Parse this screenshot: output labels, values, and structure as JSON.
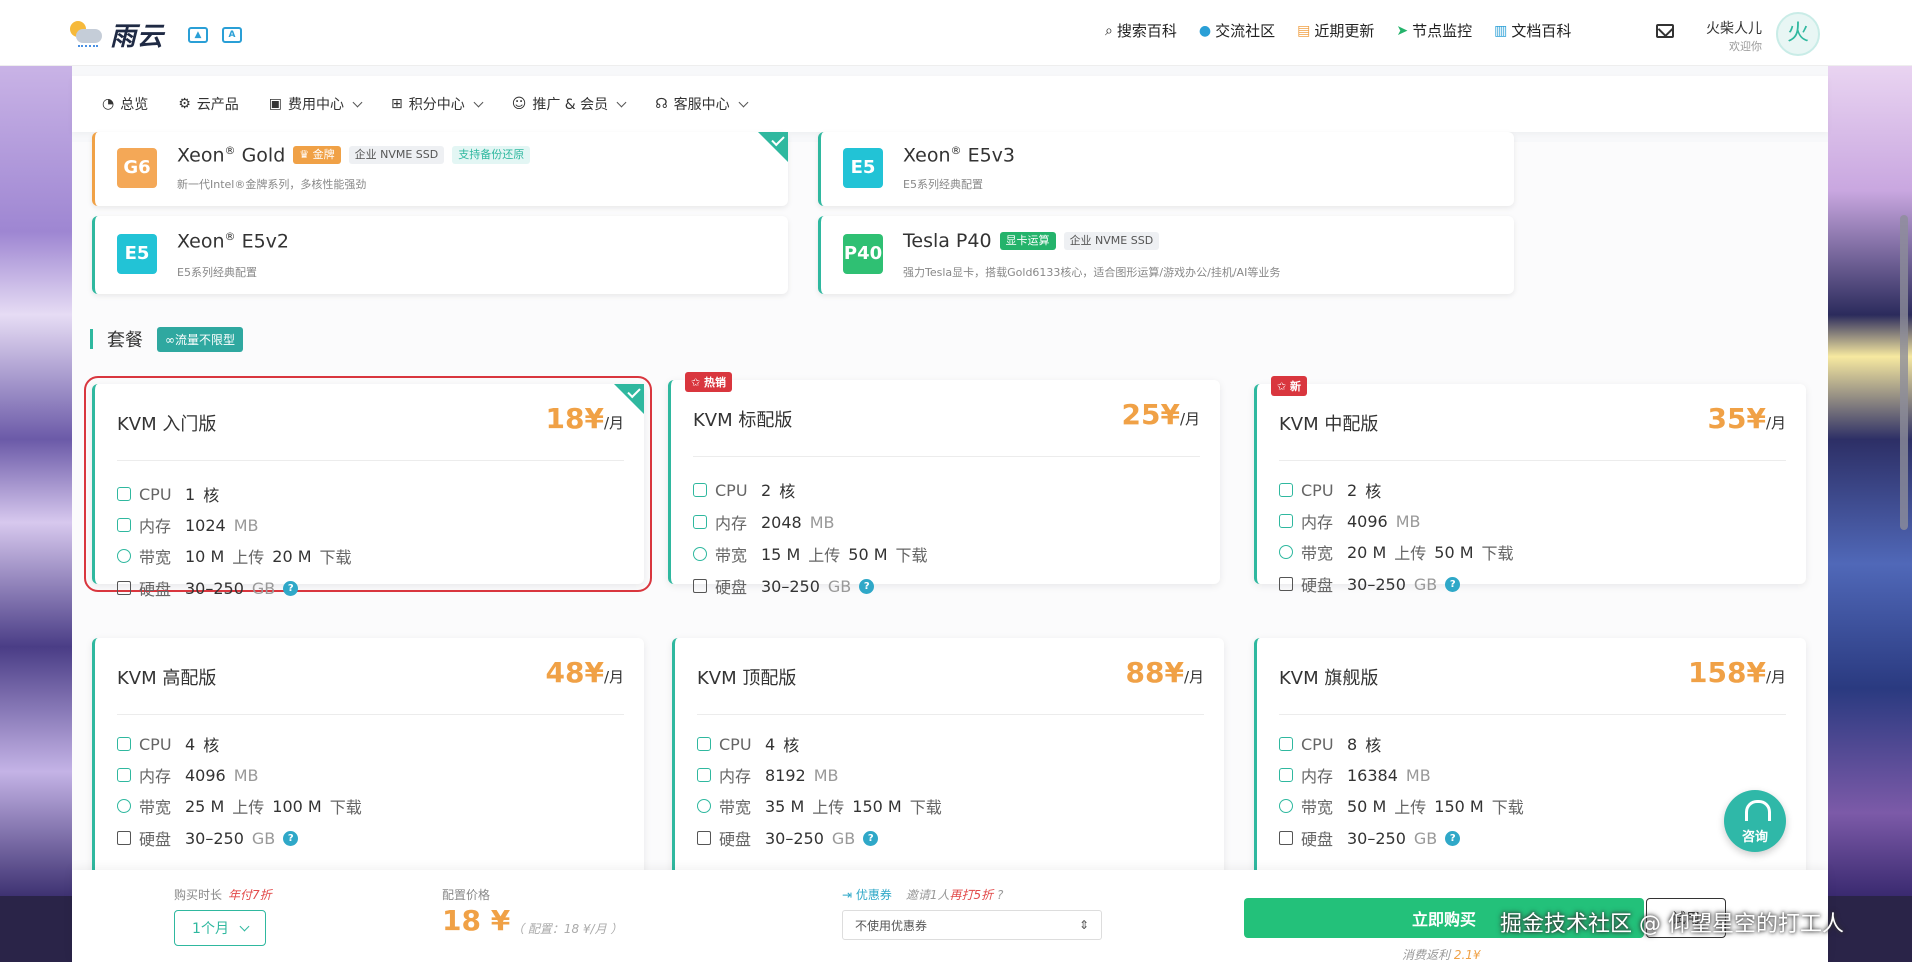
{
  "brand": {
    "name": "雨云"
  },
  "topnav": [
    {
      "icon": "search-icon",
      "glyph": "⌕",
      "label": "搜索百科"
    },
    {
      "icon": "community-icon",
      "glyph": "●",
      "label": "交流社区"
    },
    {
      "icon": "news-icon",
      "glyph": "▤",
      "label": "近期更新"
    },
    {
      "icon": "node-monitor-icon",
      "glyph": "➤",
      "label": "节点监控"
    },
    {
      "icon": "docs-icon",
      "glyph": "▥",
      "label": "文档百科"
    }
  ],
  "user": {
    "name": "火柴人儿",
    "greet": "欢迎你",
    "avatar_char": "火"
  },
  "subnav": [
    {
      "icon": "dashboard-icon",
      "glyph": "◔",
      "label": "总览",
      "dropdown": false
    },
    {
      "icon": "cloud-product-icon",
      "glyph": "⚙",
      "label": "云产品",
      "dropdown": false
    },
    {
      "icon": "billing-icon",
      "glyph": "▣",
      "label": "费用中心",
      "dropdown": true
    },
    {
      "icon": "points-icon",
      "glyph": "⊞",
      "label": "积分中心",
      "dropdown": true
    },
    {
      "icon": "promo-icon",
      "glyph": "☺",
      "label": "推广 & 会员",
      "dropdown": true
    },
    {
      "icon": "support-icon",
      "glyph": "☊",
      "label": "客服中心",
      "dropdown": true
    }
  ],
  "cpus": [
    {
      "badge": "G6",
      "badge_color": "#f4a857",
      "name": "Xeon",
      "reg": "®",
      "model": "Gold",
      "tags": [
        {
          "text": "♛ 金牌",
          "style": "gold"
        },
        {
          "text": "企业 NVME SSD",
          "style": "grey"
        },
        {
          "text": "支持备份还原",
          "style": "teal"
        }
      ],
      "desc": "新一代Intel®金牌系列，多核性能强劲"
    },
    {
      "badge": "E5",
      "badge_color": "#22c3d6",
      "name": "Xeon",
      "reg": "®",
      "model": "E5v3",
      "tags": [],
      "desc": "E5系列经典配置"
    },
    {
      "badge": "E5",
      "badge_color": "#22c3d6",
      "name": "Xeon",
      "reg": "®",
      "model": "E5v2",
      "tags": [],
      "desc": "E5系列经典配置"
    },
    {
      "badge": "P40",
      "badge_color": "#2fc073",
      "name": "Tesla P40",
      "reg": "",
      "model": "",
      "tags": [
        {
          "text": "显卡运算",
          "style": "green"
        },
        {
          "text": "企业 NVME SSD",
          "style": "grey"
        }
      ],
      "desc": "强力Tesla显卡，搭载Gold6133核心，适合图形运算/游戏办公/挂机/AI等业务"
    }
  ],
  "section": {
    "title": "套餐",
    "pill": "∞流量不限型"
  },
  "spec_labels": {
    "cpu": "CPU",
    "mem": "内存",
    "bw": "带宽",
    "disk": "硬盘",
    "core_unit": "核",
    "mem_unit": "MB",
    "up": "上传",
    "down": "下载",
    "disk_unit": "GB",
    "help": "?"
  },
  "packages": [
    {
      "name": "KVM 入门版",
      "price": "18¥",
      "per": "/月",
      "ribbon": "",
      "cpu": "1",
      "mem": "1024",
      "up": "10 M",
      "down": "20 M",
      "disk": "30–250"
    },
    {
      "name": "KVM 标配版",
      "price": "25¥",
      "per": "/月",
      "ribbon": "✩ 热销",
      "cpu": "2",
      "mem": "2048",
      "up": "15 M",
      "down": "50 M",
      "disk": "30–250"
    },
    {
      "name": "KVM 中配版",
      "price": "35¥",
      "per": "/月",
      "ribbon": "✩ 新",
      "cpu": "2",
      "mem": "4096",
      "up": "20 M",
      "down": "50 M",
      "disk": "30–250"
    },
    {
      "name": "KVM 高配版",
      "price": "48¥",
      "per": "/月",
      "ribbon": "",
      "cpu": "4",
      "mem": "4096",
      "up": "25 M",
      "down": "100 M",
      "disk": "30–250"
    },
    {
      "name": "KVM 顶配版",
      "price": "88¥",
      "per": "/月",
      "ribbon": "",
      "cpu": "4",
      "mem": "8192",
      "up": "35 M",
      "down": "150 M",
      "disk": "30–250"
    },
    {
      "name": "KVM 旗舰版",
      "price": "158¥",
      "per": "/月",
      "ribbon": "",
      "cpu": "8",
      "mem": "16384",
      "up": "50 M",
      "down": "150 M",
      "disk": "30–250"
    }
  ],
  "bottom": {
    "duration_label": "购买时长",
    "duration_hint": "年付7折",
    "duration_value": "1个月",
    "price_label": "配置价格",
    "price": "18 ¥",
    "price_note": "（ 配置：18 ¥/月 ）",
    "coupon_label": "优惠券",
    "coupon_hint_pre": "邀请1人",
    "coupon_hint_red": "再打5折",
    "coupon_hint_q": "?",
    "coupon_value": "不使用优惠券",
    "buy_label": "立即购买",
    "try_label": "试用",
    "rebate_pre": "消费返利",
    "rebate_val": "2.1¥"
  },
  "consult_label": "咨询",
  "watermark": "掘金技术社区 @ 仰望星空的打工人"
}
